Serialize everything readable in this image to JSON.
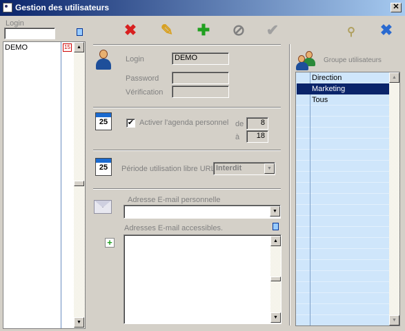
{
  "window": {
    "title": "Gestion des utilisateurs",
    "close_glyph": "✕"
  },
  "left_panel": {
    "login_label": "Login",
    "search_value": "",
    "users": [
      {
        "login": "DEMO",
        "flag": "15"
      }
    ]
  },
  "toolbar": {
    "buttons": [
      {
        "name": "delete",
        "icon": "red-x-icon",
        "glyph": "✖",
        "color": "#d82020"
      },
      {
        "name": "edit",
        "icon": "pencil-icon",
        "glyph": "✎",
        "color": "#d8a020"
      },
      {
        "name": "add",
        "icon": "green-plus-icon",
        "glyph": "✚",
        "color": "#20a020"
      },
      {
        "name": "cancel",
        "icon": "cancel-icon",
        "glyph": "⊘",
        "color": "#808080"
      },
      {
        "name": "validate",
        "icon": "check-icon",
        "glyph": "✔",
        "color": "#a0a0a0"
      }
    ],
    "right_buttons": [
      {
        "name": "tool",
        "icon": "wand-icon",
        "glyph": "⚲",
        "color": "#b0a060"
      },
      {
        "name": "close",
        "icon": "blue-x-icon",
        "glyph": "✖",
        "color": "#2a6ad0"
      }
    ]
  },
  "account": {
    "login_label": "Login",
    "login_value": "DEMO",
    "password_label": "Password",
    "password_value": "",
    "verification_label": "Vérification",
    "verification_value": ""
  },
  "agenda": {
    "checkbox_label": "Activer l'agenda personnel",
    "checked": true,
    "check_glyph": "✔",
    "from_label": "de",
    "from_value": "8",
    "to_label": "à",
    "to_value": "18",
    "calendar_day": "25"
  },
  "url": {
    "label": "Période utilisation libre URL",
    "value": "Interdit",
    "calendar_day": "25"
  },
  "email": {
    "personal_label": "Adresse E-mail personnelle",
    "personal_value": "",
    "accessible_label": "Adresses E-mail accessibles.",
    "accessible_values": []
  },
  "groups": {
    "header": "Groupe utilisateurs",
    "items": [
      {
        "label": "Direction",
        "selected": false
      },
      {
        "label": "Marketing",
        "selected": true
      },
      {
        "label": "Tous",
        "selected": false
      }
    ]
  },
  "scroll": {
    "up": "▲",
    "down": "▼"
  }
}
